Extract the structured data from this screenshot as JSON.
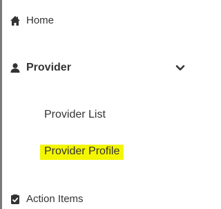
{
  "nav": {
    "home": {
      "label": "Home",
      "icon": "home-icon"
    },
    "provider": {
      "label": "Provider",
      "icon": "user-icon",
      "toggle_icon": "chevron-down-icon",
      "expanded": true
    },
    "provider_sub": [
      {
        "label": "Provider List"
      },
      {
        "label": "Provider Profile",
        "highlighted": true
      }
    ],
    "action_items": {
      "label": "Action Items",
      "icon": "clipboard-icon"
    }
  },
  "colors": {
    "highlight": "#f3f600",
    "text": "#333333",
    "left_border": "#7a7a7a"
  }
}
